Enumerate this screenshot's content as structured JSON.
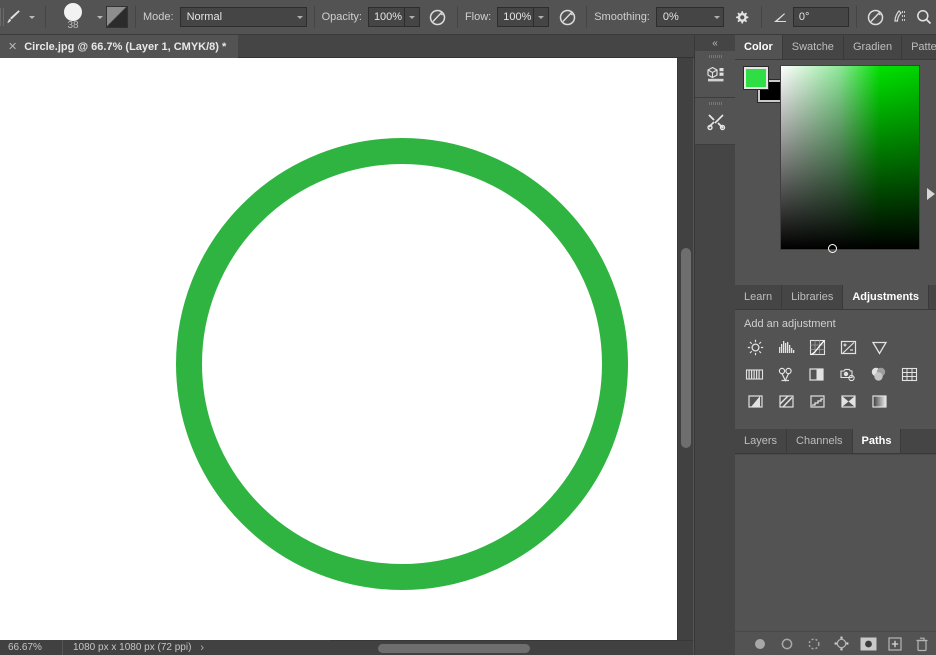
{
  "app": {
    "accent_green": "#2fb441",
    "panel_bg": "#535353",
    "ui_text": "#d4d4d4"
  },
  "options_bar": {
    "brush_tool_icon": "paintbrush-icon",
    "brush_size": "38",
    "airbrush_icon": "brush-preset-icon",
    "mode": {
      "label": "Mode:",
      "value": "Normal"
    },
    "opacity": {
      "label": "Opacity:",
      "value": "100%"
    },
    "opacity_pressure_icon": "pressure-opacity-icon",
    "flow": {
      "label": "Flow:",
      "value": "100%"
    },
    "flow_pressure_icon": "pressure-flow-icon",
    "smoothing": {
      "label": "Smoothing:",
      "value": "0%"
    },
    "smoothing_options_icon": "gear-icon",
    "angle": {
      "icon": "angle-icon",
      "value": "0°"
    },
    "symmetry_icon": "symmetry-icon",
    "tablet_pressure_icon": "tablet-pressure-icon",
    "search_icon": "search-icon",
    "workspace_icon": "workspace-icon",
    "workspace_caret_icon": "chevron-down-icon"
  },
  "document_tab": {
    "close_icon": "close-icon",
    "title": "Circle.jpg @ 66.7% (Layer 1, CMYK/8) *"
  },
  "canvas": {
    "artwork_description": "green-circle-outline",
    "ring_color": "#2fb441",
    "background": "#ffffff"
  },
  "status_bar": {
    "zoom": "66.67%",
    "dimensions": "1080 px x 1080 px (72 ppi)",
    "chevron": "›"
  },
  "icon_dock": {
    "collapse_icon": "double-chevron-left-icon",
    "buttons": [
      {
        "name": "3d-library-icon"
      },
      {
        "name": "tools-icon"
      }
    ]
  },
  "color_panel": {
    "tabs": [
      {
        "label": "Color",
        "active": true
      },
      {
        "label": "Swatche",
        "active": false
      },
      {
        "label": "Gradien",
        "active": false
      },
      {
        "label": "Patterns",
        "active": false
      }
    ],
    "foreground_color": "#2fdd44",
    "background_color": "#000000",
    "ramp_name": "green-color-ramp"
  },
  "adjustments_panel": {
    "tabs": [
      {
        "label": "Learn",
        "active": false
      },
      {
        "label": "Libraries",
        "active": false
      },
      {
        "label": "Adjustments",
        "active": true
      }
    ],
    "title": "Add an adjustment",
    "rows": [
      [
        {
          "name": "brightness-contrast-icon"
        },
        {
          "name": "levels-icon"
        },
        {
          "name": "curves-icon"
        },
        {
          "name": "exposure-icon"
        },
        {
          "name": "vibrance-icon"
        }
      ],
      [
        {
          "name": "hue-saturation-icon"
        },
        {
          "name": "color-balance-icon"
        },
        {
          "name": "black-and-white-icon"
        },
        {
          "name": "photo-filter-icon"
        },
        {
          "name": "channel-mixer-icon"
        },
        {
          "name": "color-lookup-icon"
        }
      ],
      [
        {
          "name": "invert-icon"
        },
        {
          "name": "posterize-icon"
        },
        {
          "name": "threshold-icon"
        },
        {
          "name": "gradient-map-icon"
        },
        {
          "name": "selective-color-icon"
        }
      ]
    ]
  },
  "paths_panel": {
    "tabs": [
      {
        "label": "Layers",
        "active": false
      },
      {
        "label": "Channels",
        "active": false
      },
      {
        "label": "Paths",
        "active": true
      }
    ],
    "footer_icons": [
      {
        "name": "fill-path-icon"
      },
      {
        "name": "stroke-path-icon"
      },
      {
        "name": "load-path-as-selection-icon"
      },
      {
        "name": "make-work-path-icon"
      },
      {
        "name": "add-layer-mask-icon"
      },
      {
        "name": "new-path-icon"
      },
      {
        "name": "delete-path-icon"
      }
    ]
  }
}
